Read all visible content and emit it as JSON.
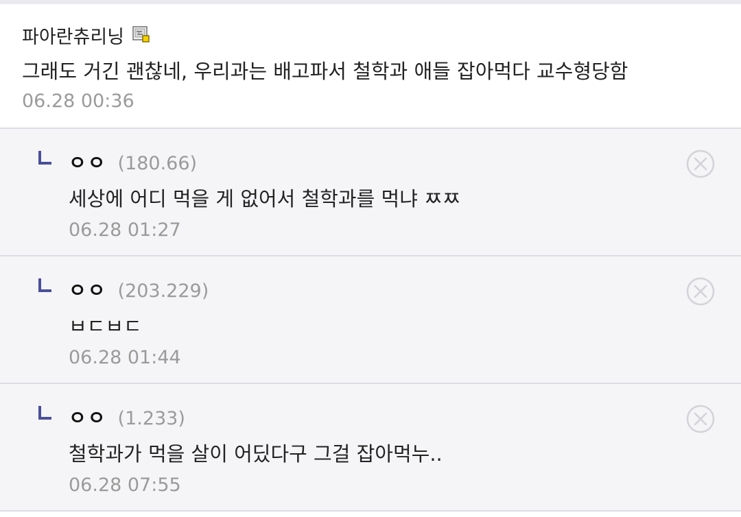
{
  "main_comment": {
    "author": "파아란츄리닝",
    "icon": "gallery-member-icon",
    "body": "그래도 거긴 괜찮네, 우리과는 배고파서 철학과 애들 잡아먹다 교수형당함",
    "timestamp": "06.28 00:36"
  },
  "replies": [
    {
      "nickname": "ㅇㅇ",
      "ip": "(180.66)",
      "body": "세상에 어디 먹을 게 없어서 철학과를 먹냐 ㅉㅉ",
      "timestamp": "06.28 01:27",
      "delete_icon": "close-circle-icon"
    },
    {
      "nickname": "ㅇㅇ",
      "ip": "(203.229)",
      "body": "ㅂㄷㅂㄷ",
      "timestamp": "06.28 01:44",
      "delete_icon": "close-circle-icon"
    },
    {
      "nickname": "ㅇㅇ",
      "ip": "(1.233)",
      "body": "철학과가 먹을 살이 어딨다구 그걸 잡아먹누..",
      "timestamp": "06.28 07:55",
      "delete_icon": "close-circle-icon"
    }
  ],
  "colors": {
    "reply_background": "#f5f5f8",
    "divider": "#dcdce4",
    "timestamp": "#9a9a9a",
    "reply_arrow": "#4a4f9a"
  }
}
